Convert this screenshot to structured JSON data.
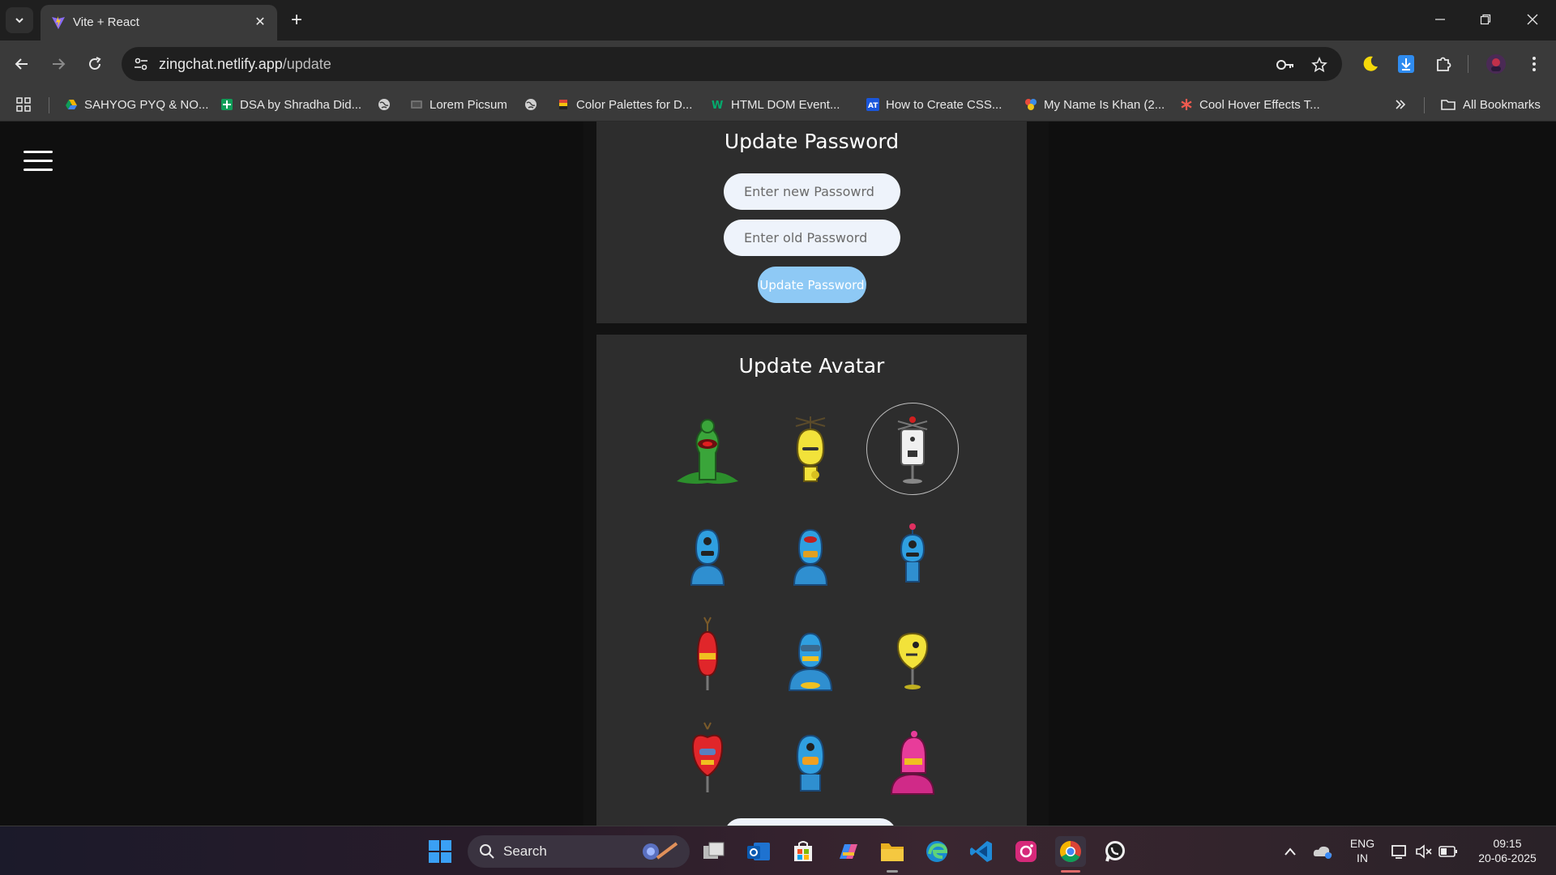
{
  "browser": {
    "tab_title": "Vite + React",
    "url_host": "zingchat.netlify.app",
    "url_path": "/update",
    "bookmarks": [
      {
        "label": "SAHYOG PYQ & NO...",
        "icon": "google-drive-icon"
      },
      {
        "label": "DSA by Shradha Did...",
        "icon": "google-sheets-icon"
      },
      {
        "label": "",
        "icon": "globe-icon"
      },
      {
        "label": "Lorem Picsum",
        "icon": "picsum-icon"
      },
      {
        "label": "",
        "icon": "globe-icon"
      },
      {
        "label": "Color Palettes for D...",
        "icon": "palette-icon"
      },
      {
        "label": "HTML DOM Event...",
        "icon": "w3schools-icon"
      },
      {
        "label": "How to Create CSS...",
        "icon": "css-icon"
      },
      {
        "label": "My Name Is Khan (2...",
        "icon": "movie-icon"
      },
      {
        "label": "Cool Hover Effects T...",
        "icon": "asterisk-icon"
      }
    ],
    "all_bookmarks": "All Bookmarks"
  },
  "page": {
    "password_card": {
      "title": "Update Password",
      "new_password_placeholder": "Enter new Passowrd",
      "old_password_placeholder": "Enter old Password",
      "button_label": "Update Password"
    },
    "avatar_card": {
      "title": "Update Avatar",
      "avatars": [
        {
          "name": "green-alien-robot",
          "color": "#3aa53a",
          "selected": false
        },
        {
          "name": "yellow-propeller-robot",
          "color": "#f2e23a",
          "selected": false
        },
        {
          "name": "white-box-robot",
          "color": "#f0f0f0",
          "selected": true
        },
        {
          "name": "blue-robot-1",
          "color": "#2f9fe0",
          "selected": false
        },
        {
          "name": "blue-robot-2",
          "color": "#2f9fe0",
          "selected": false
        },
        {
          "name": "blue-robot-3",
          "color": "#2f9fe0",
          "selected": false
        },
        {
          "name": "red-antenna-robot",
          "color": "#e0262a",
          "selected": false
        },
        {
          "name": "blue-visor-robot",
          "color": "#2f9fe0",
          "selected": false
        },
        {
          "name": "yellow-pin-robot",
          "color": "#f2e23a",
          "selected": false
        },
        {
          "name": "red-heart-robot",
          "color": "#e0262a",
          "selected": false
        },
        {
          "name": "blue-grin-robot",
          "color": "#2f9fe0",
          "selected": false
        },
        {
          "name": "pink-knight-robot",
          "color": "#e83c9a",
          "selected": false
        }
      ]
    }
  },
  "taskbar": {
    "search_label": "Search",
    "language_line1": "ENG",
    "language_line2": "IN",
    "time": "09:15",
    "date": "20-06-2025"
  },
  "colors": {
    "accent_button": "#8ec9f5",
    "card_bg": "#2d2d2d",
    "page_bg": "#0f0f0f"
  }
}
